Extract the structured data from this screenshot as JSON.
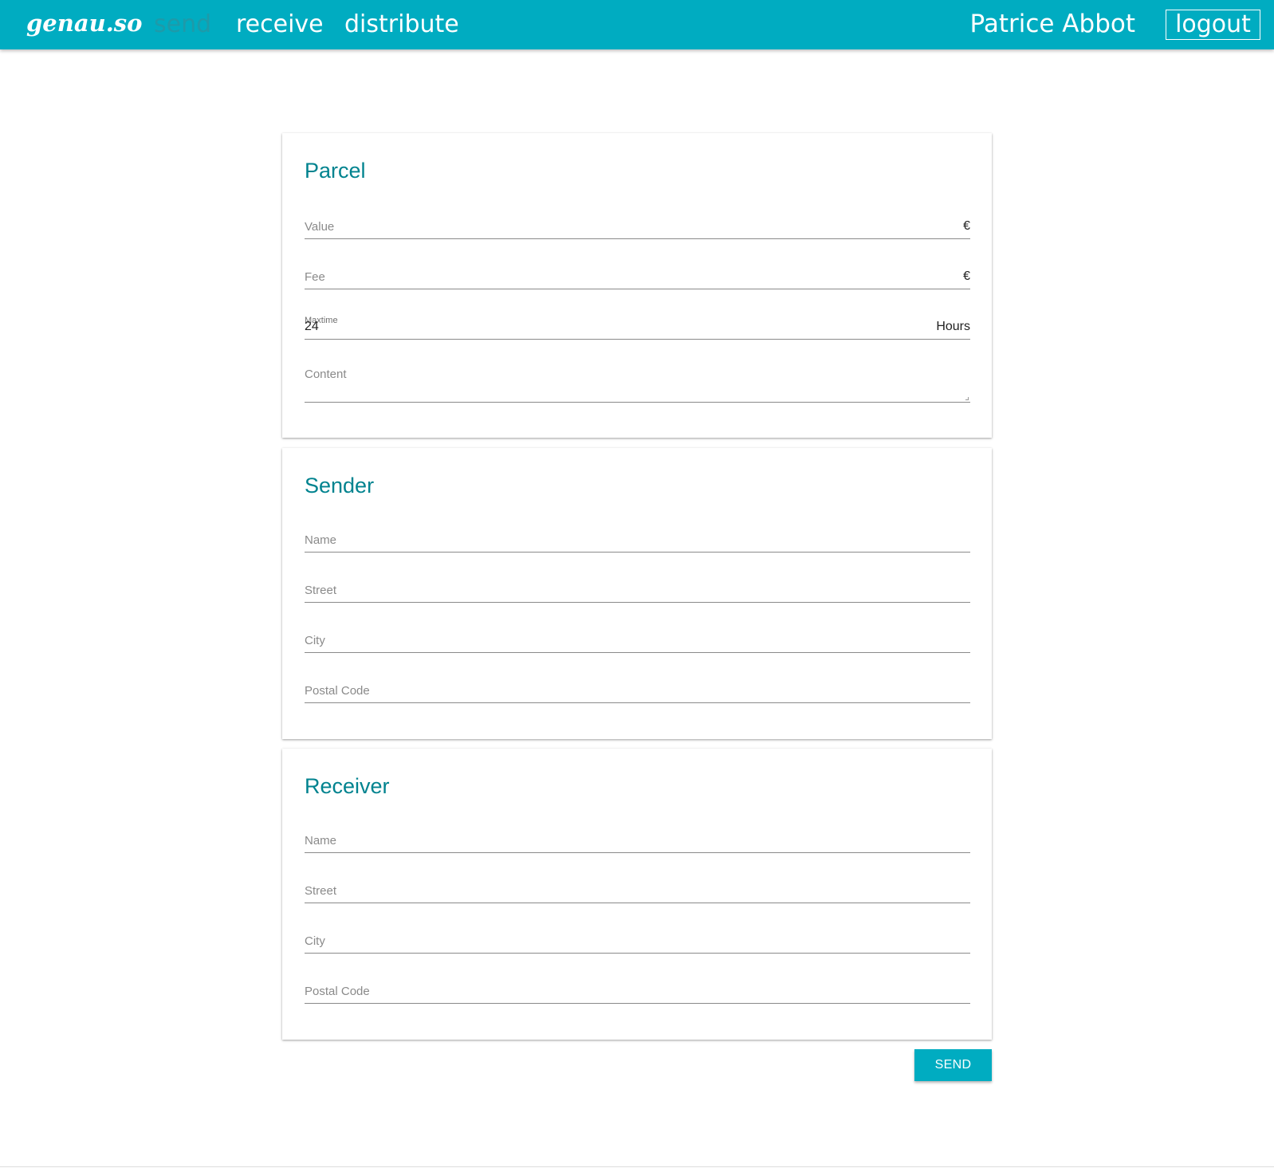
{
  "header": {
    "logo": "genau.so",
    "nav": {
      "send": "send",
      "receive": "receive",
      "distribute": "distribute"
    },
    "user_name": "Patrice Abbot",
    "logout_label": "logout",
    "active_nav": "send"
  },
  "parcel": {
    "title": "Parcel",
    "value_label": "Value",
    "value_suffix": "€",
    "fee_label": "Fee",
    "fee_suffix": "€",
    "maxtime_label": "Maxtime",
    "maxtime_value": "24",
    "maxtime_suffix": "Hours",
    "content_label": "Content"
  },
  "sender": {
    "title": "Sender",
    "name_label": "Name",
    "street_label": "Street",
    "city_label": "City",
    "postal_label": "Postal Code"
  },
  "receiver": {
    "title": "Receiver",
    "name_label": "Name",
    "street_label": "Street",
    "city_label": "City",
    "postal_label": "Postal Code"
  },
  "actions": {
    "send_label": "SEND"
  },
  "colors": {
    "primary": "#00acc1",
    "title": "#00838f",
    "nav_active": "#1e9aa9"
  }
}
